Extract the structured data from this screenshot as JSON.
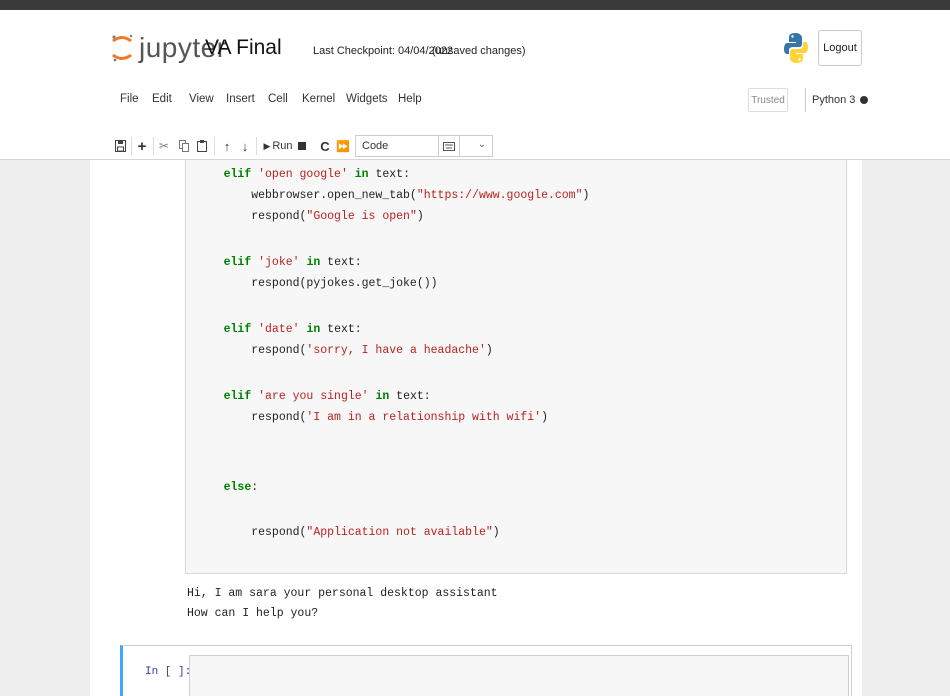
{
  "app": {
    "logo_text": "jupyter",
    "notebook_title": "VA Final",
    "checkpoint": "Last Checkpoint: 04/04/2022",
    "save_status": "(unsaved changes)",
    "logout_label": "Logout"
  },
  "menu": {
    "items": [
      "File",
      "Edit",
      "View",
      "Insert",
      "Cell",
      "Kernel",
      "Widgets",
      "Help"
    ],
    "trusted_label": "Trusted",
    "kernel_name": "Python 3"
  },
  "toolbar": {
    "buttons": [
      "save-icon",
      "add-cell-icon",
      "cut-icon",
      "copy-icon",
      "paste-icon",
      "move-up-icon",
      "move-down-icon"
    ],
    "run_label": "Run",
    "interrupt_icon": "stop-icon",
    "restart_icon": "restart-icon",
    "run_all_icon": "fast-forward-icon",
    "cell_type": "Code",
    "command_palette_icon": "keyboard-icon"
  },
  "code": {
    "lines": [
      [
        "    ",
        "elif",
        " ",
        "'open google'",
        " ",
        "in",
        " text:"
      ],
      [
        "        webbrowser.open_new_tab(",
        "\"https://www.google.com\"",
        ")"
      ],
      [
        "        respond(",
        "\"Google is open\"",
        ")"
      ],
      [
        "    ",
        "elif",
        " ",
        "'joke'",
        " ",
        "in",
        " text:"
      ],
      [
        "        respond(pyjokes.get_joke())"
      ],
      [
        "    ",
        "elif",
        " ",
        "'date'",
        " ",
        "in",
        " text:"
      ],
      [
        "        respond(",
        "'sorry, I have a headache'",
        ")"
      ],
      [
        "    ",
        "elif",
        " ",
        "'are you single'",
        " ",
        "in",
        " text:"
      ],
      [
        "        respond(",
        "'I am in a relationship with wifi'",
        ")"
      ],
      [
        "    ",
        "else",
        ":"
      ],
      [
        "        respond(",
        "\"Application not available\"",
        ")"
      ]
    ]
  },
  "output": {
    "lines": [
      "Hi, I am sara your personal desktop assistant",
      "How can I help you?"
    ]
  },
  "next_cell": {
    "prompt": "In [ ]:"
  }
}
